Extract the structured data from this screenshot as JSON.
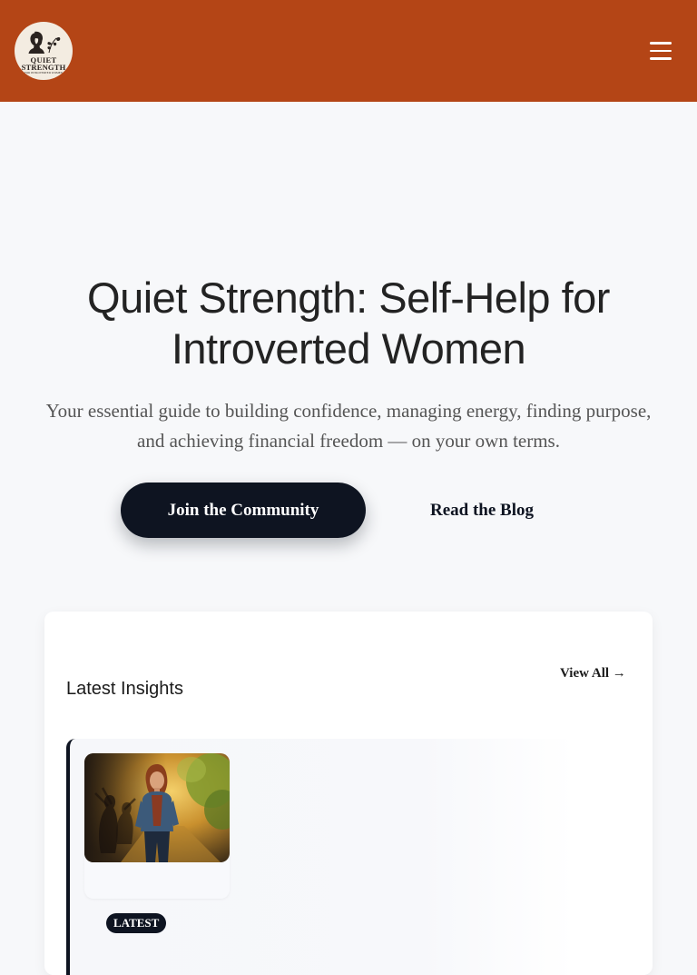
{
  "header": {
    "logo": {
      "name": "QUIET",
      "name2": "STRENGTH",
      "tagline": "FOR INTROVERTED WOMEN"
    },
    "menu_icon": "hamburger-icon"
  },
  "hero": {
    "title": "Quiet Strength: Self-Help for Introverted Women",
    "subtitle": "Your essential guide to building confidence, managing energy, finding purpose, and achieving financial freedom — on your own terms.",
    "primary_cta": "Join the Community",
    "secondary_cta": "Read the Blog"
  },
  "insights": {
    "heading": "Latest Insights",
    "view_all": "View All →",
    "posts": [
      {
        "badge": "LATEST"
      }
    ]
  },
  "colors": {
    "header_bg": "#b44516",
    "page_bg": "#f7f8fa",
    "dark": "#0e1421",
    "text": "#232323",
    "muted": "#555555"
  }
}
